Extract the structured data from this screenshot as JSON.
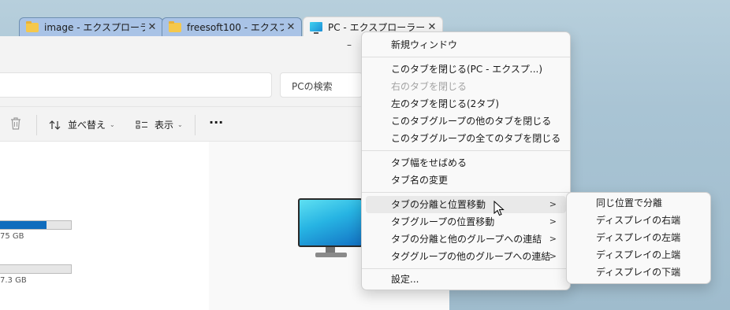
{
  "tabs": [
    {
      "label": "image - エクスプローラー",
      "icon": "folder-icon"
    },
    {
      "label": "freesoft100 - エクスプ…",
      "icon": "folder-icon"
    },
    {
      "label": "PC - エクスプローラー",
      "icon": "pc-icon"
    }
  ],
  "tab_close_glyph": "✕",
  "window": {
    "minimize_glyph": "–",
    "search_placeholder": "PCの検索"
  },
  "toolbar": {
    "delete_icon": "trash-icon",
    "sort_label": "並べ替え",
    "view_label": "表示",
    "more_label": "···"
  },
  "drives": [
    {
      "size_text": "75 GB",
      "used_fraction": 0.66
    },
    {
      "size_text": "7.3 GB",
      "used_fraction": 0.0
    }
  ],
  "context_menu": {
    "items": [
      {
        "label": "新規ウィンドウ"
      },
      {
        "label": "このタブを閉じる(PC - エクスプ...)"
      },
      {
        "label": "右のタブを閉じる",
        "disabled": true
      },
      {
        "label": "左のタブを閉じる(2タブ)"
      },
      {
        "label": "このタブグループの他のタブを閉じる"
      },
      {
        "label": "このタブグループの全てのタブを閉じる"
      },
      {
        "label": "タブ幅をせばめる"
      },
      {
        "label": "タブ名の変更"
      },
      {
        "label": "タブの分離と位置移動",
        "submenu": true,
        "highlighted": true
      },
      {
        "label": "タブグループの位置移動",
        "submenu": true
      },
      {
        "label": "タブの分離と他のグループへの連結",
        "submenu": true
      },
      {
        "label": "タググループの他のグループへの連結",
        "submenu": true
      },
      {
        "label": "設定..."
      }
    ],
    "submenu_arrow": ">"
  },
  "sub_menu": {
    "items": [
      {
        "label": "同じ位置で分離"
      },
      {
        "label": "ディスプレイの右端"
      },
      {
        "label": "ディスプレイの左端"
      },
      {
        "label": "ディスプレイの上端"
      },
      {
        "label": "ディスプレイの下端"
      }
    ]
  },
  "colors": {
    "accent": "#0f6cbd",
    "inactive_tab": "#a9c3e6",
    "desktop": "#a9c4d4"
  }
}
